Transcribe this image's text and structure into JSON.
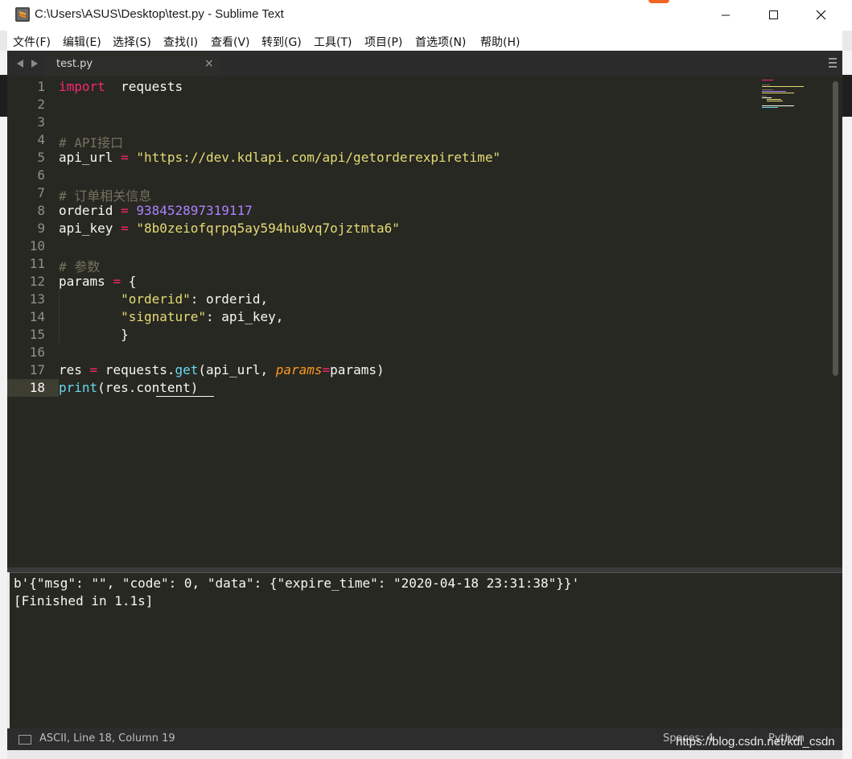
{
  "window": {
    "title": "C:\\Users\\ASUS\\Desktop\\test.py - Sublime Text",
    "controls": [
      "minimize",
      "maximize",
      "close"
    ]
  },
  "menu": [
    "文件(F)",
    "编辑(E)",
    "选择(S)",
    "查找(I)",
    "查看(V)",
    "转到(G)",
    "工具(T)",
    "项目(P)",
    "首选项(N)",
    "帮助(H)"
  ],
  "tab": {
    "label": "test.py",
    "close": "×"
  },
  "editor": {
    "line_numbers": [
      "1",
      "2",
      "3",
      "4",
      "5",
      "6",
      "7",
      "8",
      "9",
      "10",
      "11",
      "12",
      "13",
      "14",
      "15",
      "16",
      "17",
      "18"
    ],
    "active_line": "18",
    "code_lines": [
      [
        [
          "kw",
          "import"
        ],
        [
          "",
          "  requests"
        ]
      ],
      [],
      [],
      [
        [
          "cmt",
          "# API接口"
        ]
      ],
      [
        [
          "",
          "api_url "
        ],
        [
          "kw",
          "="
        ],
        [
          "",
          ""
        ],
        [
          "str",
          " \"https://dev.kdlapi.com/api/getorderexpiretime\""
        ]
      ],
      [],
      [
        [
          "cmt",
          "# 订单相关信息"
        ]
      ],
      [
        [
          "",
          "orderid "
        ],
        [
          "kw",
          "="
        ],
        [
          "num",
          " 938452897319117"
        ]
      ],
      [
        [
          "",
          "api_key "
        ],
        [
          "kw",
          "="
        ],
        [
          "str",
          " \"8b0zeiofqrpq5ay594hu8vq7ojztmta6\""
        ]
      ],
      [],
      [
        [
          "cmt",
          "# 参数"
        ]
      ],
      [
        [
          "",
          "params "
        ],
        [
          "kw",
          "="
        ],
        [
          "",
          " {"
        ]
      ],
      [
        [
          "",
          "        "
        ],
        [
          "str",
          "\"orderid\""
        ],
        [
          "",
          ": orderid,"
        ]
      ],
      [
        [
          "",
          "        "
        ],
        [
          "str",
          "\"signature\""
        ],
        [
          "",
          ": api_key,"
        ]
      ],
      [
        [
          "",
          "        }"
        ]
      ],
      [],
      [
        [
          "",
          "res "
        ],
        [
          "kw",
          "="
        ],
        [
          "",
          " requests."
        ],
        [
          "fn",
          "get"
        ],
        [
          "",
          "(api_url, "
        ],
        [
          "par",
          "params"
        ],
        [
          "kw",
          "="
        ],
        [
          "",
          "params)"
        ]
      ],
      [
        [
          "fn",
          "print"
        ],
        [
          "",
          "(res.content)"
        ]
      ]
    ]
  },
  "output": {
    "lines": [
      "b'{\"msg\": \"\", \"code\": 0, \"data\": {\"expire_time\": \"2020-04-18 23:31:38\"}}'",
      "[Finished in 1.1s]"
    ]
  },
  "status": {
    "position": "ASCII, Line 18, Column 19",
    "spaces": "Spaces: 4",
    "syntax": "Python"
  },
  "watermark": "https://blog.csdn.net/kdl_csdn",
  "colors": {
    "editor_bg": "#272822",
    "keyword": "#f92672",
    "string": "#e6db74",
    "number": "#ae81ff",
    "comment": "#75715e",
    "function": "#66d9ef"
  }
}
